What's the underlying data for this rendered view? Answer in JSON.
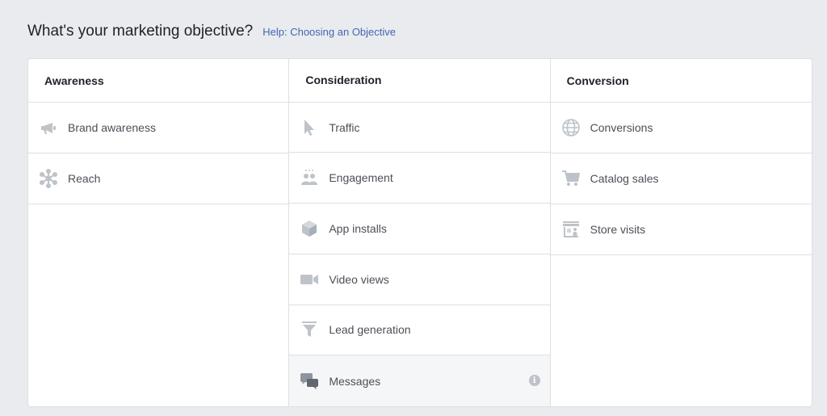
{
  "header": {
    "title": "What's your marketing objective?",
    "help_link": "Help: Choosing an Objective"
  },
  "icon_color": "#bec3c9",
  "columns": [
    {
      "heading": "Awareness",
      "options": [
        {
          "label": "Brand awareness",
          "icon": "megaphone-icon"
        },
        {
          "label": "Reach",
          "icon": "reach-icon"
        }
      ]
    },
    {
      "heading": "Consideration",
      "options": [
        {
          "label": "Traffic",
          "icon": "cursor-icon"
        },
        {
          "label": "Engagement",
          "icon": "people-icon"
        },
        {
          "label": "App installs",
          "icon": "box-icon"
        },
        {
          "label": "Video views",
          "icon": "video-camera-icon"
        },
        {
          "label": "Lead generation",
          "icon": "funnel-icon"
        },
        {
          "label": "Messages",
          "icon": "chat-bubbles-icon",
          "highlighted": true
        }
      ]
    },
    {
      "heading": "Conversion",
      "options": [
        {
          "label": "Conversions",
          "icon": "globe-icon"
        },
        {
          "label": "Catalog sales",
          "icon": "cart-icon"
        },
        {
          "label": "Store visits",
          "icon": "storefront-icon"
        }
      ]
    }
  ],
  "info_glyph": "i"
}
